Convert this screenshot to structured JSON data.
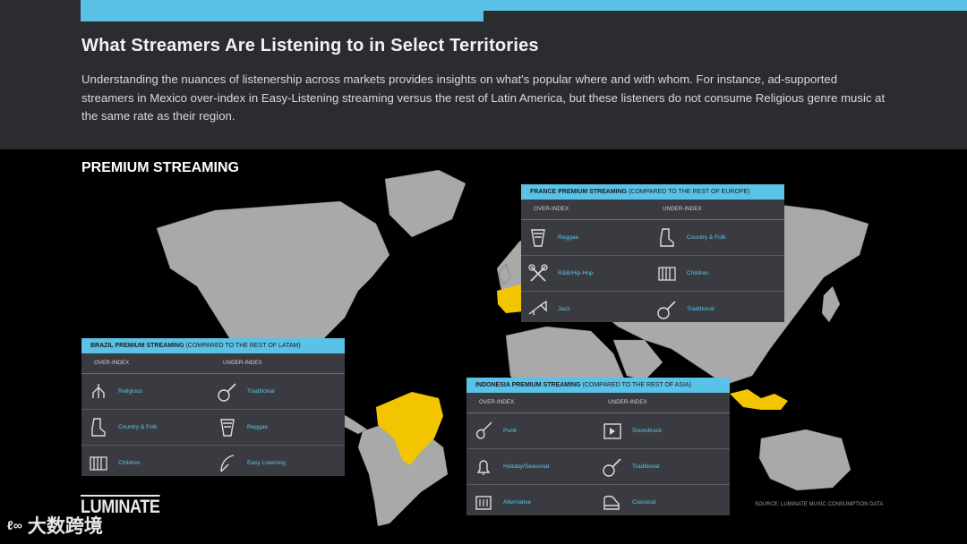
{
  "header": {
    "title": "What Streamers Are Listening to in Select Territories",
    "intro": "Understanding the nuances of listenership across markets provides insights on what's popular where and with whom. For instance, ad-supported streamers in Mexico over-index in Easy-Listening streaming versus the rest of Latin America, but these listeners do not consume Religious genre music at the same rate as their region."
  },
  "section_label": "PREMIUM STREAMING",
  "colors": {
    "accent": "#5bc2e7",
    "highlight_country": "#f2c500",
    "land": "#a9a9a9",
    "panel": "#3a3b40"
  },
  "col_over": "OVER-INDEX",
  "col_under": "UNDER-INDEX",
  "france": {
    "title": "FRANCE PREMIUM STREAMING",
    "subtitle": " (COMPARED TO THE REST OF EUROPE)",
    "rows": [
      {
        "over": "Reggae",
        "over_icon": "drum-icon",
        "under": "Country & Folk",
        "under_icon": "cowboy-boot-icon"
      },
      {
        "over": "R&B/Hip-Hop",
        "over_icon": "crossed-microphones-icon",
        "under": "Children",
        "under_icon": "xylophone-icon"
      },
      {
        "over": "Jazz",
        "over_icon": "trumpet-icon",
        "under": "Traditional",
        "under_icon": "banjo-icon"
      }
    ]
  },
  "brazil": {
    "title": "BRAZIL PREMIUM STREAMING",
    "subtitle": " (COMPARED TO THE REST OF LATAM)",
    "rows": [
      {
        "over": "Religious",
        "over_icon": "praying-hands-icon",
        "under": "Traditional",
        "under_icon": "banjo-icon"
      },
      {
        "over": "Country & Folk",
        "over_icon": "cowboy-boot-icon",
        "under": "Reggae",
        "under_icon": "drum-icon"
      },
      {
        "over": "Children",
        "over_icon": "xylophone-icon",
        "under": "Easy Listening",
        "under_icon": "feather-icon"
      }
    ]
  },
  "indonesia": {
    "title": "INDONESIA PREMIUM STREAMING",
    "subtitle": " (COMPARED TO THE REST OF ASIA)",
    "rows": [
      {
        "over": "Punk",
        "over_icon": "electric-guitar-icon",
        "under": "Soundtrack",
        "under_icon": "film-play-icon"
      },
      {
        "over": "Holiday/Seasonal",
        "over_icon": "bell-icon",
        "under": "Traditional",
        "under_icon": "banjo-icon"
      },
      {
        "over": "Alternative",
        "over_icon": "mixer-icon",
        "under": "Classical",
        "under_icon": "grand-piano-icon"
      }
    ]
  },
  "logo": "LUMINATE",
  "source": "SOURCE: LUMINATE MUSIC CONSUMPTION DATA",
  "watermark": "大数跨境",
  "watermark_mark": "ℓ∞"
}
